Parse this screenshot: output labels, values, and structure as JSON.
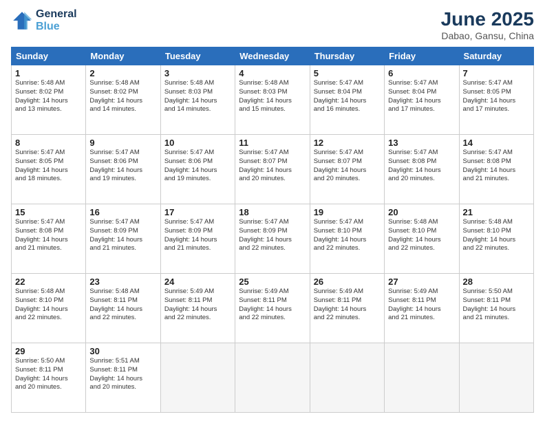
{
  "header": {
    "logo_line1": "General",
    "logo_line2": "Blue",
    "title": "June 2025",
    "subtitle": "Dabao, Gansu, China"
  },
  "days_of_week": [
    "Sunday",
    "Monday",
    "Tuesday",
    "Wednesday",
    "Thursday",
    "Friday",
    "Saturday"
  ],
  "weeks": [
    [
      {
        "day": 1,
        "info": "Sunrise: 5:48 AM\nSunset: 8:02 PM\nDaylight: 14 hours\nand 13 minutes."
      },
      {
        "day": 2,
        "info": "Sunrise: 5:48 AM\nSunset: 8:02 PM\nDaylight: 14 hours\nand 14 minutes."
      },
      {
        "day": 3,
        "info": "Sunrise: 5:48 AM\nSunset: 8:03 PM\nDaylight: 14 hours\nand 14 minutes."
      },
      {
        "day": 4,
        "info": "Sunrise: 5:48 AM\nSunset: 8:03 PM\nDaylight: 14 hours\nand 15 minutes."
      },
      {
        "day": 5,
        "info": "Sunrise: 5:47 AM\nSunset: 8:04 PM\nDaylight: 14 hours\nand 16 minutes."
      },
      {
        "day": 6,
        "info": "Sunrise: 5:47 AM\nSunset: 8:04 PM\nDaylight: 14 hours\nand 17 minutes."
      },
      {
        "day": 7,
        "info": "Sunrise: 5:47 AM\nSunset: 8:05 PM\nDaylight: 14 hours\nand 17 minutes."
      }
    ],
    [
      {
        "day": 8,
        "info": "Sunrise: 5:47 AM\nSunset: 8:05 PM\nDaylight: 14 hours\nand 18 minutes."
      },
      {
        "day": 9,
        "info": "Sunrise: 5:47 AM\nSunset: 8:06 PM\nDaylight: 14 hours\nand 19 minutes."
      },
      {
        "day": 10,
        "info": "Sunrise: 5:47 AM\nSunset: 8:06 PM\nDaylight: 14 hours\nand 19 minutes."
      },
      {
        "day": 11,
        "info": "Sunrise: 5:47 AM\nSunset: 8:07 PM\nDaylight: 14 hours\nand 20 minutes."
      },
      {
        "day": 12,
        "info": "Sunrise: 5:47 AM\nSunset: 8:07 PM\nDaylight: 14 hours\nand 20 minutes."
      },
      {
        "day": 13,
        "info": "Sunrise: 5:47 AM\nSunset: 8:08 PM\nDaylight: 14 hours\nand 20 minutes."
      },
      {
        "day": 14,
        "info": "Sunrise: 5:47 AM\nSunset: 8:08 PM\nDaylight: 14 hours\nand 21 minutes."
      }
    ],
    [
      {
        "day": 15,
        "info": "Sunrise: 5:47 AM\nSunset: 8:08 PM\nDaylight: 14 hours\nand 21 minutes."
      },
      {
        "day": 16,
        "info": "Sunrise: 5:47 AM\nSunset: 8:09 PM\nDaylight: 14 hours\nand 21 minutes."
      },
      {
        "day": 17,
        "info": "Sunrise: 5:47 AM\nSunset: 8:09 PM\nDaylight: 14 hours\nand 21 minutes."
      },
      {
        "day": 18,
        "info": "Sunrise: 5:47 AM\nSunset: 8:09 PM\nDaylight: 14 hours\nand 22 minutes."
      },
      {
        "day": 19,
        "info": "Sunrise: 5:47 AM\nSunset: 8:10 PM\nDaylight: 14 hours\nand 22 minutes."
      },
      {
        "day": 20,
        "info": "Sunrise: 5:48 AM\nSunset: 8:10 PM\nDaylight: 14 hours\nand 22 minutes."
      },
      {
        "day": 21,
        "info": "Sunrise: 5:48 AM\nSunset: 8:10 PM\nDaylight: 14 hours\nand 22 minutes."
      }
    ],
    [
      {
        "day": 22,
        "info": "Sunrise: 5:48 AM\nSunset: 8:10 PM\nDaylight: 14 hours\nand 22 minutes."
      },
      {
        "day": 23,
        "info": "Sunrise: 5:48 AM\nSunset: 8:11 PM\nDaylight: 14 hours\nand 22 minutes."
      },
      {
        "day": 24,
        "info": "Sunrise: 5:49 AM\nSunset: 8:11 PM\nDaylight: 14 hours\nand 22 minutes."
      },
      {
        "day": 25,
        "info": "Sunrise: 5:49 AM\nSunset: 8:11 PM\nDaylight: 14 hours\nand 22 minutes."
      },
      {
        "day": 26,
        "info": "Sunrise: 5:49 AM\nSunset: 8:11 PM\nDaylight: 14 hours\nand 22 minutes."
      },
      {
        "day": 27,
        "info": "Sunrise: 5:49 AM\nSunset: 8:11 PM\nDaylight: 14 hours\nand 21 minutes."
      },
      {
        "day": 28,
        "info": "Sunrise: 5:50 AM\nSunset: 8:11 PM\nDaylight: 14 hours\nand 21 minutes."
      }
    ],
    [
      {
        "day": 29,
        "info": "Sunrise: 5:50 AM\nSunset: 8:11 PM\nDaylight: 14 hours\nand 20 minutes."
      },
      {
        "day": 30,
        "info": "Sunrise: 5:51 AM\nSunset: 8:11 PM\nDaylight: 14 hours\nand 20 minutes."
      },
      null,
      null,
      null,
      null,
      null
    ]
  ]
}
